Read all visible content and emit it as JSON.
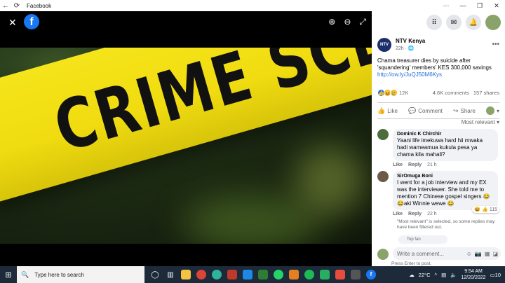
{
  "window": {
    "title": "Facebook"
  },
  "viewer": {
    "photo_text": "CRIME SCENE DO"
  },
  "post": {
    "page_name": "NTV Kenya",
    "page_logo": "NTV",
    "time": "22h ·",
    "text": "Chama treasurer dies by suicide after 'squandering' members' KES 300,000 savings",
    "link": "http://ow.ly/JuQJ50M6Kys",
    "reaction_count": "12K",
    "comments_count": "4.6K comments",
    "shares_count": "157 shares",
    "actions": {
      "like": "Like",
      "comment": "Comment",
      "share": "Share"
    },
    "sort": "Most relevant ▾"
  },
  "comments": [
    {
      "name": "Dominic K Chirchir",
      "text": "Yaani life imekuwa hard hii mwaka hadi wameamua kukula pesa ya chama kila mahali?",
      "like": "Like",
      "reply": "Reply",
      "time": "21 h"
    },
    {
      "name": "SirOmuga Boni",
      "text": "I went for a job interview and my EX was the interviewer. She told me to mention 7 Chinese gospel singers 😂😂aki Winnie wewe 😂",
      "like": "Like",
      "reply": "Reply",
      "time": "22 h",
      "reactions": "115"
    }
  ],
  "filter_note": "\"Most relevant\" is selected, so some replies may have been filtered out.",
  "top_fan": "Top fan",
  "compose": {
    "placeholder": "Write a comment...",
    "hint": "Press Enter to post."
  },
  "taskbar": {
    "search_placeholder": "Type here to search",
    "weather": "22°C",
    "time": "9:54 AM",
    "date": "12/20/2022",
    "notification_count": "10"
  },
  "colors": {
    "facebook_blue": "#1877f2",
    "tape_yellow": "#f5e41a",
    "taskbar": "#1c2a3a"
  }
}
